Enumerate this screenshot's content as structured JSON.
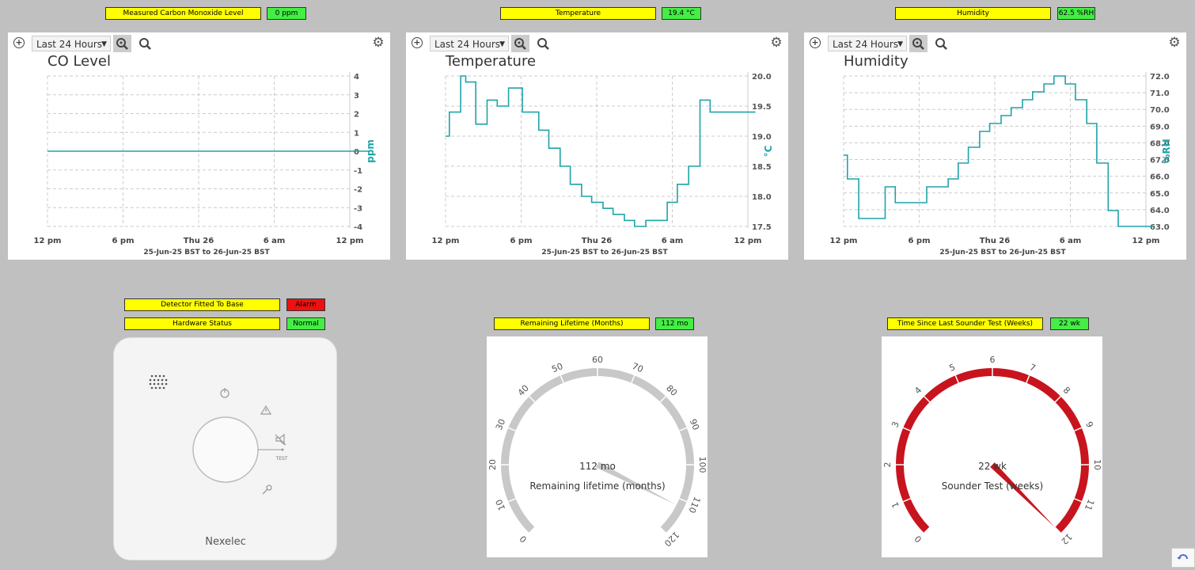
{
  "indicators": {
    "co": {
      "label": "Measured Carbon Monoxide Level",
      "value": "0 ppm"
    },
    "temp": {
      "label": "Temperature",
      "value": "19.4 °C"
    },
    "hum": {
      "label": "Humidity",
      "value": "62.5 %RH"
    },
    "fitted": {
      "label": "Detector Fitted To Base",
      "value": "Alarm"
    },
    "hardware": {
      "label": "Hardware Status",
      "value": "Normal"
    },
    "lifetime": {
      "label": "Remaining Lifetime (Months)",
      "value": "112 mo"
    },
    "sounder": {
      "label": "Time Since Last Sounder Test (Weeks)",
      "value": "22 wk"
    }
  },
  "colors": {
    "label_bg": "#ffff00",
    "ok": "#44ee44",
    "alarm": "#ee1111",
    "series": "#1fa3a8",
    "lifetime_gauge": "#c8c8c8",
    "sounder_gauge": "#c8141e"
  },
  "range_select": "Last 24 Hours",
  "chart_data": [
    {
      "type": "line",
      "title": "CO Level",
      "ylabel": "ppm",
      "xlabel": "25-Jun-25 BST to 26-Jun-25 BST",
      "x_ticks": [
        "12 pm",
        "6 pm",
        "Thu 26",
        "6 am",
        "12 pm"
      ],
      "y_ticks": [
        "4",
        "3",
        "2",
        "1",
        "0",
        "-1",
        "-2",
        "-3",
        "-4"
      ],
      "ylim": [
        -4,
        4
      ],
      "xlim": [
        0,
        24
      ],
      "series": [
        {
          "x": [
            0,
            25.5
          ],
          "y": [
            0,
            0
          ]
        }
      ]
    },
    {
      "type": "line",
      "title": "Temperature",
      "ylabel": "°C",
      "xlabel": "25-Jun-25 BST to 26-Jun-25 BST",
      "x_ticks": [
        "12 pm",
        "6 pm",
        "Thu 26",
        "6 am",
        "12 pm"
      ],
      "y_ticks": [
        "20.0",
        "19.5",
        "19.0",
        "18.5",
        "18.0",
        "17.5"
      ],
      "ylim": [
        17.5,
        20.0
      ],
      "xlim": [
        0,
        24
      ],
      "series": [
        {
          "x": [
            0,
            0.3,
            0.3,
            1.2,
            1.2,
            1.6,
            1.6,
            2.4,
            2.4,
            3.3,
            3.3,
            4.1,
            4.1,
            5.0,
            5.0,
            6.1,
            6.1,
            7.4,
            7.4,
            8.2,
            8.2,
            9.1,
            9.1,
            9.9,
            9.9,
            10.8,
            10.8,
            11.6,
            11.6,
            12.5,
            12.5,
            13.3,
            13.3,
            14.2,
            14.2,
            15.0,
            15.0,
            15.9,
            15.9,
            17.6,
            17.6,
            18.4,
            18.4,
            19.3,
            19.3,
            20.2,
            20.2,
            21.0,
            21.0,
            21.9,
            21.9,
            22.7,
            22.7,
            23.6,
            23.6,
            24.3,
            24.3,
            24.6
          ],
          "y": [
            19.0,
            19.0,
            19.4,
            19.4,
            20.0,
            20.0,
            19.9,
            19.9,
            19.2,
            19.2,
            19.6,
            19.6,
            19.5,
            19.5,
            19.8,
            19.8,
            19.4,
            19.4,
            19.1,
            19.1,
            18.8,
            18.8,
            18.5,
            18.5,
            18.2,
            18.2,
            18.0,
            18.0,
            17.9,
            17.9,
            17.8,
            17.8,
            17.7,
            17.7,
            17.6,
            17.6,
            17.5,
            17.5,
            17.6,
            17.6,
            17.9,
            17.9,
            18.2,
            18.2,
            18.5,
            18.5,
            19.6,
            19.6,
            19.4,
            19.4,
            19.4,
            19.4,
            19.4,
            19.4,
            19.4,
            19.4,
            19.4,
            19.4
          ]
        }
      ]
    },
    {
      "type": "line",
      "title": "Humidity",
      "ylabel": "%RH",
      "xlabel": "25-Jun-25 BST to 26-Jun-25 BST",
      "x_ticks": [
        "12 pm",
        "6 pm",
        "Thu 26",
        "6 am",
        "12 pm"
      ],
      "y_ticks": [
        "72.0",
        "71.0",
        "70.0",
        "69.0",
        "68.0",
        "67.0",
        "66.0",
        "65.0",
        "64.0",
        "63.0"
      ],
      "ylim": [
        62.5,
        72.0
      ],
      "xlim": [
        0,
        24
      ],
      "series": [
        {
          "x": [
            0,
            0.3,
            0.3,
            1.2,
            1.2,
            3.3,
            3.3,
            4.1,
            4.1,
            6.6,
            6.6,
            8.3,
            8.3,
            9.1,
            9.1,
            9.9,
            9.9,
            10.8,
            10.8,
            11.6,
            11.6,
            12.5,
            12.5,
            13.3,
            13.3,
            14.2,
            14.2,
            15.0,
            15.0,
            15.9,
            15.9,
            16.7,
            16.7,
            17.6,
            17.6,
            18.4,
            18.4,
            19.3,
            19.3,
            20.1,
            20.1,
            21.0,
            21.0,
            21.8,
            21.8,
            22.6,
            22.6,
            23.5,
            23.5,
            24.6
          ],
          "y": [
            67.0,
            67.0,
            65.5,
            65.5,
            63.0,
            63.0,
            65.0,
            65.0,
            64.0,
            64.0,
            65.0,
            65.0,
            65.5,
            65.5,
            66.5,
            66.5,
            67.5,
            67.5,
            68.5,
            68.5,
            69.0,
            69.0,
            69.5,
            69.5,
            70.0,
            70.0,
            70.5,
            70.5,
            71.0,
            71.0,
            71.5,
            71.5,
            72.0,
            72.0,
            71.5,
            71.5,
            70.5,
            70.5,
            69.0,
            69.0,
            66.5,
            66.5,
            63.5,
            63.5,
            62.5,
            62.5,
            62.5,
            62.5,
            62.5,
            62.5
          ]
        }
      ]
    }
  ],
  "gauges": {
    "lifetime": {
      "min": 0,
      "max": 120,
      "ticks": [
        "0",
        "10",
        "20",
        "30",
        "40",
        "50",
        "60",
        "70",
        "80",
        "90",
        "100",
        "110",
        "120"
      ],
      "value": 112,
      "readout": "112 mo",
      "caption": "Remaining lifetime (months)"
    },
    "sounder": {
      "min": 0,
      "max": 12,
      "ticks": [
        "0",
        "1",
        "2",
        "3",
        "4",
        "5",
        "6",
        "7",
        "8",
        "9",
        "10",
        "11",
        "12"
      ],
      "value": 12,
      "readout": "22 wk",
      "caption": "Sounder Test (weeks)"
    }
  },
  "device": {
    "brand": "Nexelec",
    "test_label": "TEST"
  }
}
